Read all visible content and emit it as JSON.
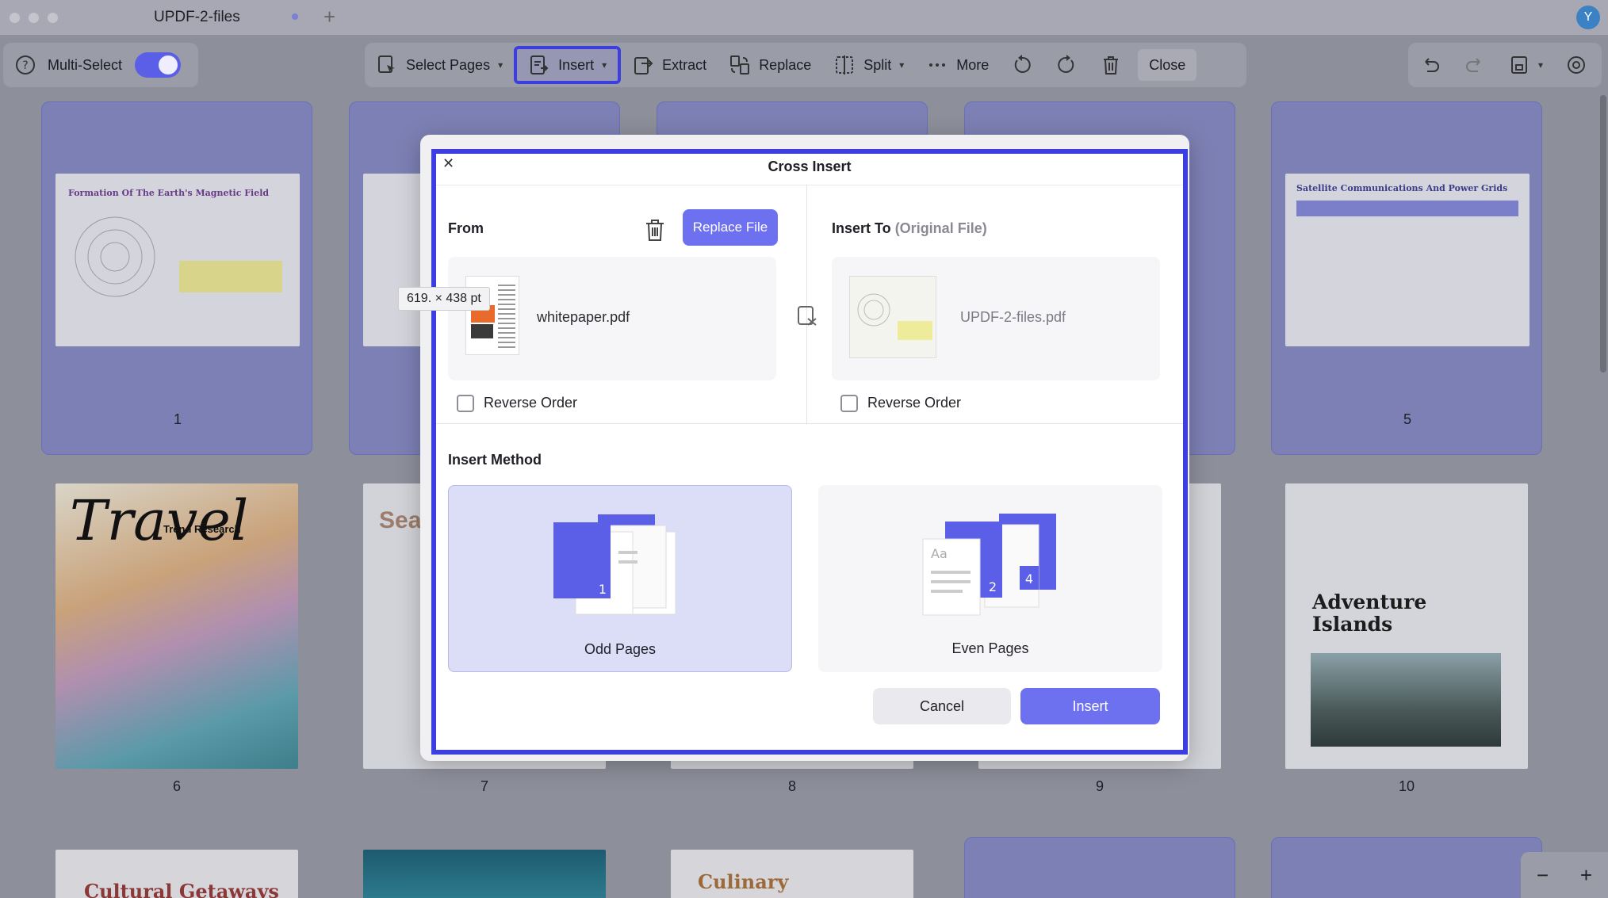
{
  "window": {
    "tab_title": "UPDF-2-files",
    "user_initial": "Y"
  },
  "toolbar": {
    "multi_select_label": "Multi-Select",
    "select_pages_label": "Select Pages",
    "insert_label": "Insert",
    "extract_label": "Extract",
    "replace_label": "Replace",
    "split_label": "Split",
    "more_label": "More",
    "close_label": "Close"
  },
  "pages": [
    {
      "number": "1",
      "title": "Formation Of The Earth's Magnetic Field"
    },
    {
      "number": "5",
      "title": "Satellite Communications And Power Grids"
    },
    {
      "number": "6",
      "title": "Travel",
      "subtitle": "Trend Research"
    },
    {
      "number": "7",
      "title": "Sea"
    },
    {
      "number": "8"
    },
    {
      "number": "9"
    },
    {
      "number": "10",
      "title": "Adventure Islands"
    },
    {
      "title": "Cultural Getaways"
    },
    {
      "title": "Culinary"
    }
  ],
  "tooltip": {
    "text": "619. × 438 pt"
  },
  "dialog": {
    "title": "Cross Insert",
    "from_label": "From",
    "replace_file_label": "Replace File",
    "from_file": "whitepaper.pdf",
    "insert_to_label": "Insert To",
    "insert_to_hint": "(Original File)",
    "to_file": "UPDF-2-files.pdf",
    "reverse_order_label": "Reverse Order",
    "insert_method_label": "Insert Method",
    "odd_pages_label": "Odd Pages",
    "even_pages_label": "Even Pages",
    "cancel_label": "Cancel",
    "insert_label": "Insert"
  },
  "colors": {
    "accent": "#3d3ee0",
    "primary_button": "#6d70ef",
    "selected_card": "#dcddf7"
  }
}
